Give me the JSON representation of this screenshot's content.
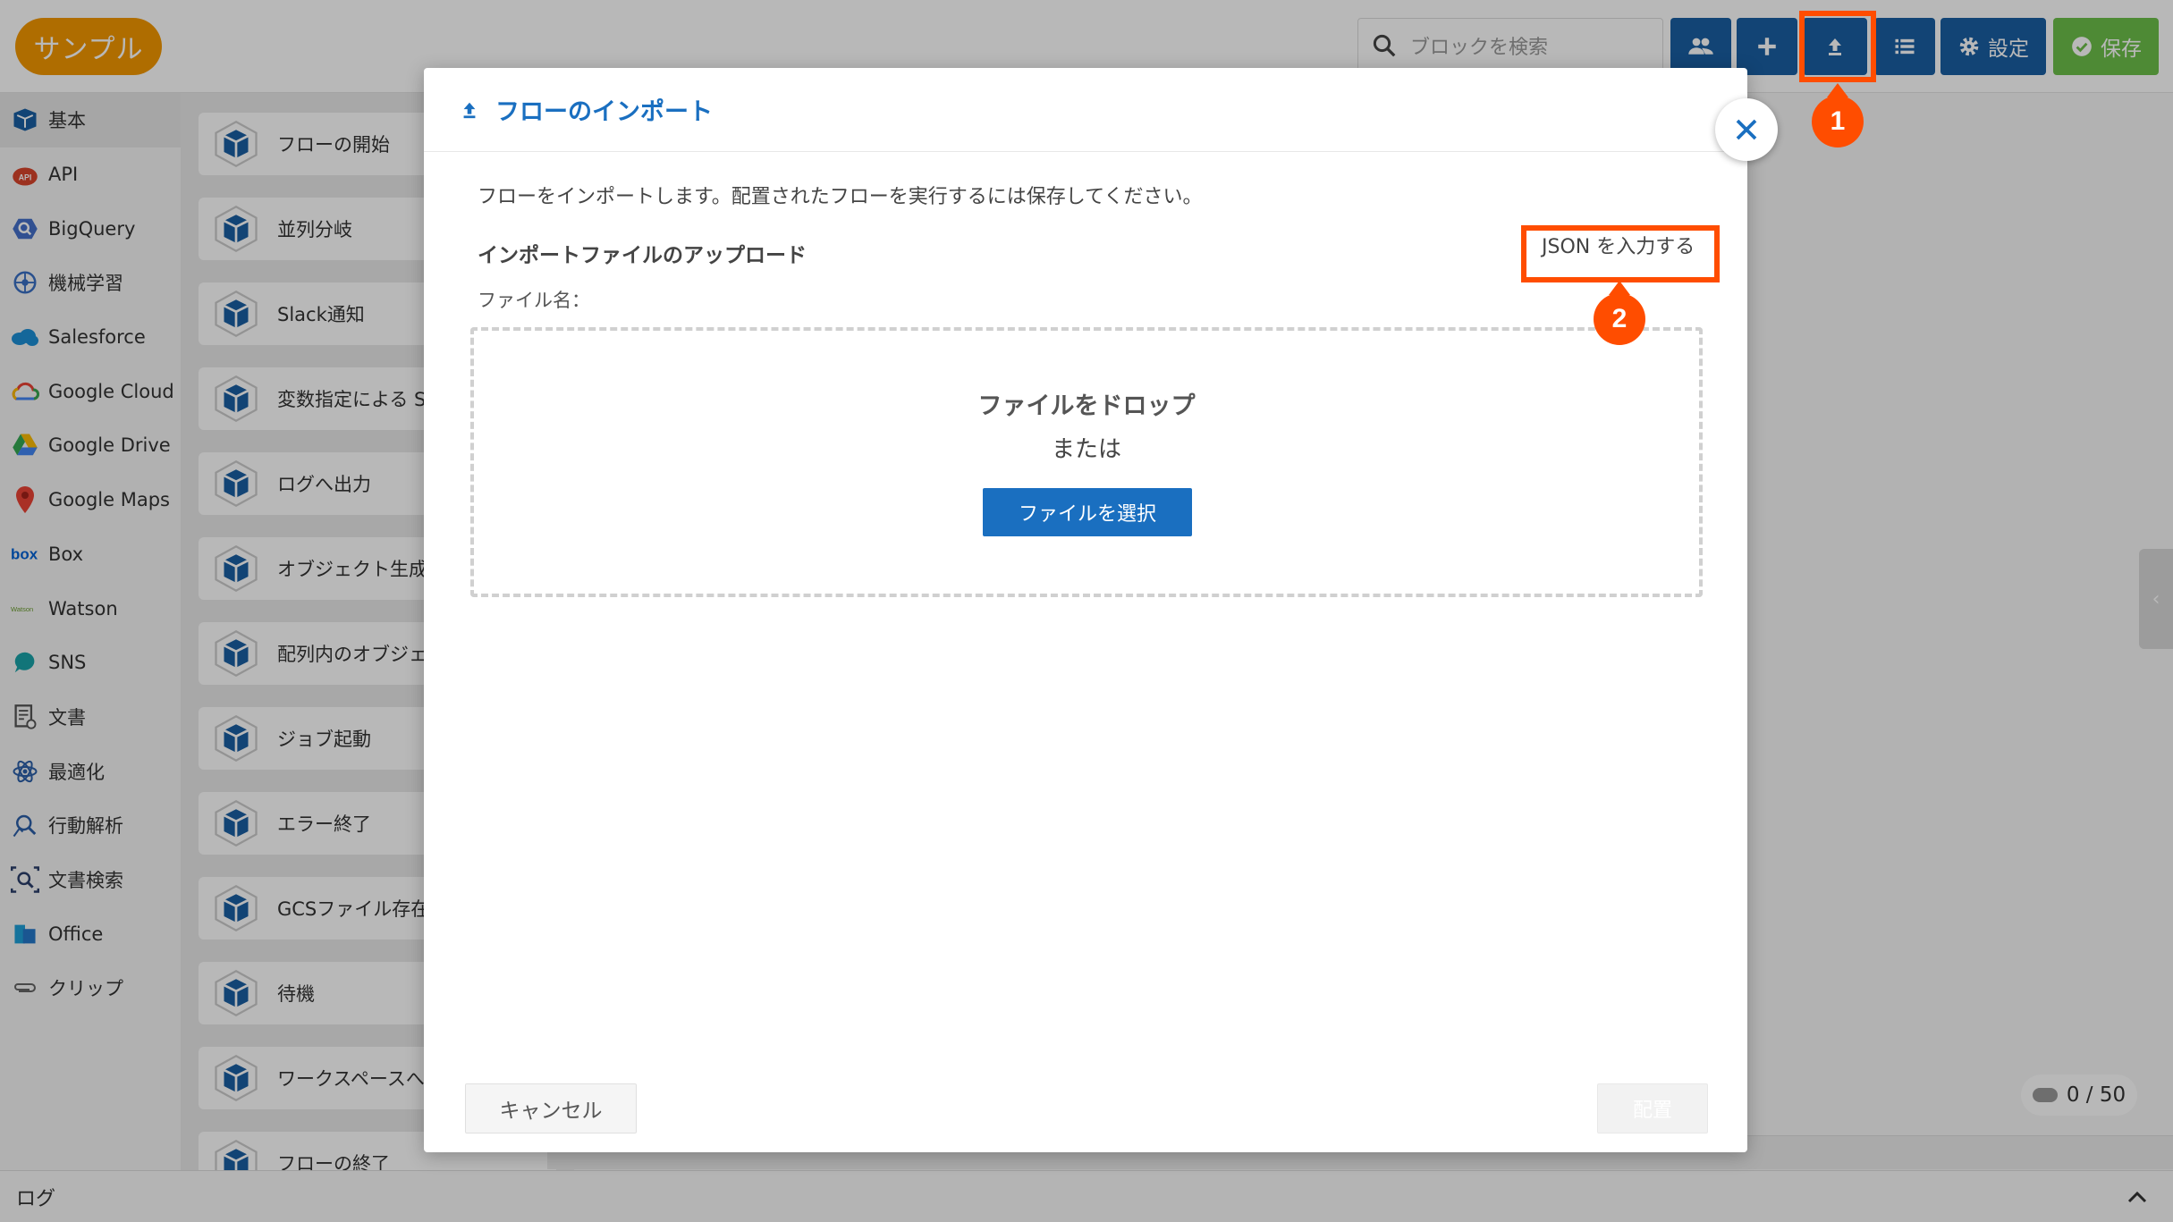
{
  "app": {
    "logo_text": "サンプル"
  },
  "toolbar": {
    "search_placeholder": "ブロックを検索",
    "settings_label": "設定",
    "save_label": "保存"
  },
  "annotations": {
    "step1": "1",
    "step2": "2"
  },
  "sidebar": {
    "items": [
      {
        "label": "基本",
        "icon": "cube-icon"
      },
      {
        "label": "API",
        "icon": "api-icon"
      },
      {
        "label": "BigQuery",
        "icon": "bigquery-icon"
      },
      {
        "label": "機械学習",
        "icon": "brain-icon"
      },
      {
        "label": "Salesforce",
        "icon": "salesforce-cloud-icon"
      },
      {
        "label": "Google Cloud",
        "icon": "google-cloud-icon"
      },
      {
        "label": "Google Drive",
        "icon": "google-drive-icon"
      },
      {
        "label": "Google Maps",
        "icon": "map-pin-icon"
      },
      {
        "label": "Box",
        "icon": "box-icon"
      },
      {
        "label": "Watson",
        "icon": "watson-icon"
      },
      {
        "label": "SNS",
        "icon": "chat-bubble-icon"
      },
      {
        "label": "文書",
        "icon": "document-icon"
      },
      {
        "label": "最適化",
        "icon": "atom-icon"
      },
      {
        "label": "行動解析",
        "icon": "behavior-icon"
      },
      {
        "label": "文書検索",
        "icon": "document-search-icon"
      },
      {
        "label": "Office",
        "icon": "office-icon"
      },
      {
        "label": "クリップ",
        "icon": "paperclip-icon"
      }
    ]
  },
  "blocks": {
    "items": [
      {
        "label": "フローの開始"
      },
      {
        "label": "並列分岐"
      },
      {
        "label": "Slack通知"
      },
      {
        "label": "変数指定による S"
      },
      {
        "label": "ログへ出力"
      },
      {
        "label": "オブジェクト生成"
      },
      {
        "label": "配列内のオブジェ 変換"
      },
      {
        "label": "ジョブ起動"
      },
      {
        "label": "エラー終了"
      },
      {
        "label": "GCSファイル存在"
      },
      {
        "label": "待機"
      },
      {
        "label": "ワークスペースへ ジを送信"
      },
      {
        "label": "フローの終了"
      }
    ]
  },
  "canvas": {
    "counter_text": "0 / 50"
  },
  "bottom_bar": {
    "label": "ログ"
  },
  "modal": {
    "title": "フローのインポート",
    "description": "フローをインポートします。配置されたフローを実行するには保存してください。",
    "upload_label": "インポートファイルのアップロード",
    "json_link": "JSON を入力する",
    "filename_label": "ファイル名：",
    "drop_title": "ファイルをドロップ",
    "drop_or": "または",
    "select_button": "ファイルを選択",
    "cancel_button": "キャンセル",
    "place_button": "配置"
  },
  "colors": {
    "accent": "#1a6fc0",
    "highlight": "#ff4d00",
    "logo": "#f39800",
    "save": "#6cbf4a"
  }
}
